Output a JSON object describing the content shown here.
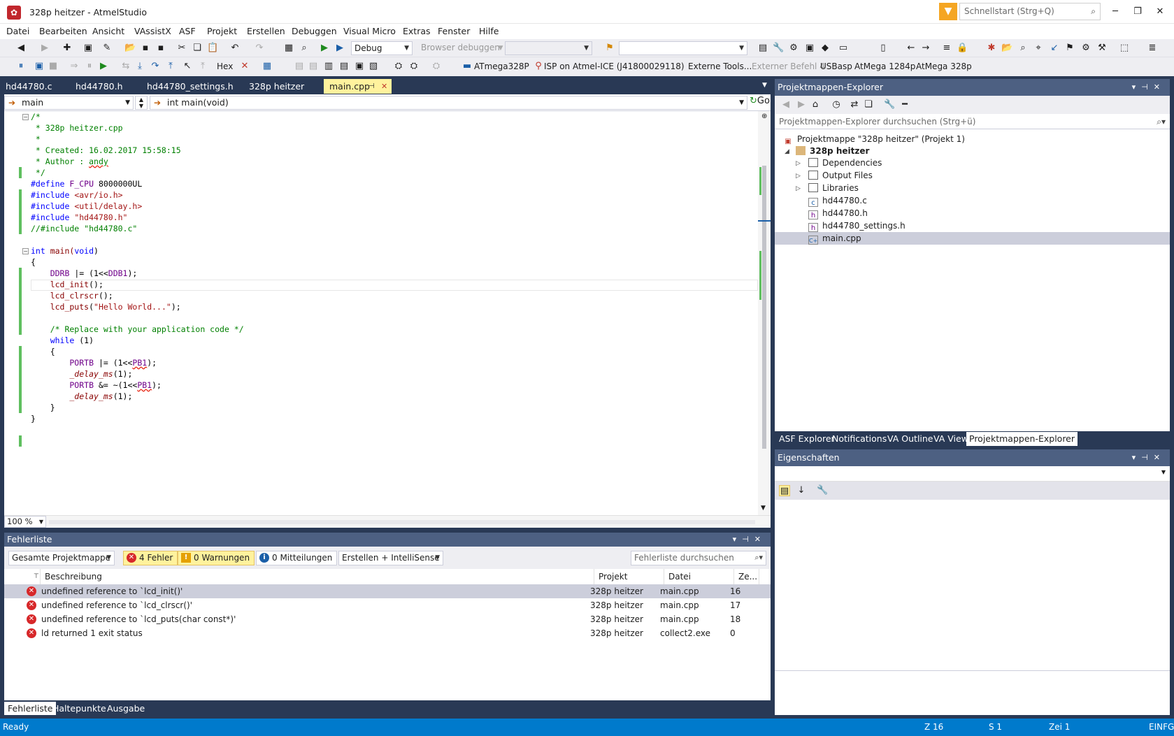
{
  "window": {
    "title": "328p heitzer - AtmelStudio",
    "quicklaunch_placeholder": "Schnellstart (Strg+Q)"
  },
  "menu": [
    "Datei",
    "Bearbeiten",
    "Ansicht",
    "VAssistX",
    "ASF",
    "Projekt",
    "Erstellen",
    "Debuggen",
    "Visual Micro",
    "Extras",
    "Fenster",
    "Hilfe"
  ],
  "toolbar1": {
    "config": "Debug",
    "browser_debug": "Browser debuggen"
  },
  "toolbar2": {
    "hex": "Hex",
    "device": "ATmega328P",
    "tool": "ISP on Atmel-ICE (J41800029118)",
    "external_tools": "Externe Tools...",
    "external_cmd": "Externer Befehl 4",
    "usbasp": "USBasp",
    "atmega1284": "AtMega 1284p",
    "atmega328": "AtMega 328p"
  },
  "doc_tabs": [
    "hd44780.c",
    "hd44780.h",
    "hd44780_settings.h",
    "328p heitzer",
    "main.cpp"
  ],
  "nav": {
    "scope": "main",
    "member": "int main(void)",
    "go": "Go"
  },
  "code": {
    "l1": "/*",
    "l2": " * 328p heitzer.cpp",
    "l3": " *",
    "l4": " * Created: 16.02.2017 15:58:15",
    "l5a": " * Author : ",
    "l5b": "andy",
    "l6": " */",
    "l7a": "#define",
    "l7b": " F_CPU",
    "l7c": " 8000000UL",
    "l8a": "#include",
    "l8b": " <avr/io.h>",
    "l9a": "#include",
    "l9b": " <util/delay.h>",
    "l10a": "#include",
    "l10b": " \"hd44780.h\"",
    "l11": "//#include \"hd44780.c\"",
    "l13a": "int",
    "l13b": " main(",
    "l13c": "void",
    "l13d": ")",
    "l14": "{",
    "l15a": "    DDRB",
    "l15b": " |= (1<<",
    "l15c": "DDB1",
    "l15d": ");",
    "l16a": "    lcd_init",
    "l16b": "();",
    "l17a": "    lcd_clrscr",
    "l17b": "();",
    "l18a": "    lcd_puts",
    "l18b": "(",
    "l18c": "\"Hello World...\"",
    "l18d": ");",
    "l20": "    /* Replace with your application code */",
    "l21a": "    while",
    "l21b": " (1)",
    "l22": "    {",
    "l23a": "        PORTB",
    "l23b": " |= (1<<",
    "l23c": "PB1",
    "l23d": ");",
    "l24a": "        _delay_ms",
    "l24b": "(1);",
    "l25a": "        PORTB",
    "l25b": " &= ~(1<<",
    "l25c": "PB1",
    "l25d": ");",
    "l26a": "        _delay_ms",
    "l26b": "(1);",
    "l27": "    }",
    "l28": "}"
  },
  "zoom": "100 %",
  "error_list": {
    "title": "Fehlerliste",
    "scope": "Gesamte Projektmappe",
    "errors_chip": "4 Fehler",
    "warnings_chip": "0 Warnungen",
    "messages_chip": "0 Mitteilungen",
    "build_filter": "Erstellen + IntelliSense",
    "search_placeholder": "Fehlerliste durchsuchen",
    "columns": {
      "desc": "Beschreibung",
      "project": "Projekt",
      "file": "Datei",
      "line": "Ze..."
    },
    "rows": [
      {
        "desc": "undefined reference to `lcd_init()'",
        "project": "328p heitzer",
        "file": "main.cpp",
        "line": "16"
      },
      {
        "desc": "undefined reference to `lcd_clrscr()'",
        "project": "328p heitzer",
        "file": "main.cpp",
        "line": "17"
      },
      {
        "desc": "undefined reference to `lcd_puts(char const*)'",
        "project": "328p heitzer",
        "file": "main.cpp",
        "line": "18"
      },
      {
        "desc": "ld returned 1 exit status",
        "project": "328p heitzer",
        "file": "collect2.exe",
        "line": "0"
      }
    ]
  },
  "bottom_tabs": [
    "Fehlerliste",
    "Haltepunkte",
    "Ausgabe"
  ],
  "solution_explorer": {
    "title": "Projektmappen-Explorer",
    "search_placeholder": "Projektmappen-Explorer durchsuchen (Strg+ü)",
    "solution": "Projektmappe \"328p heitzer\" (Projekt 1)",
    "project": "328p heitzer",
    "items": [
      "Dependencies",
      "Output Files",
      "Libraries",
      "hd44780.c",
      "hd44780.h",
      "hd44780_settings.h",
      "main.cpp"
    ]
  },
  "side_tabs": [
    "ASF Explorer",
    "Notifications",
    "VA Outline",
    "VA View",
    "Projektmappen-Explorer"
  ],
  "properties": {
    "title": "Eigenschaften"
  },
  "status": {
    "ready": "Ready",
    "line": "Z 16",
    "col": "S 1",
    "char": "Zei 1",
    "mode": "EINFG"
  },
  "colors": {
    "accent": "#007acc",
    "panel_header": "#4d6082",
    "background": "#293955",
    "active_tab": "#fff29d",
    "error": "#d7282a"
  }
}
